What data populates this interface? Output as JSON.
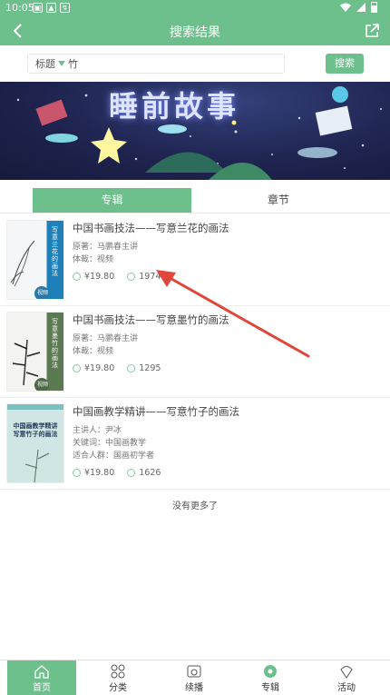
{
  "status_bar": {
    "time": "10:05"
  },
  "header": {
    "title": "搜索结果"
  },
  "search": {
    "field_label": "标题",
    "query": "竹",
    "button_label": "搜索"
  },
  "banner": {
    "title": "睡前故事"
  },
  "tabs": [
    {
      "label": "专辑",
      "active": true
    },
    {
      "label": "章节",
      "active": false
    }
  ],
  "results": [
    {
      "title": "中国书画技法——写意兰花的画法",
      "meta": [
        "原著：马鹏春主讲",
        "体裁：视频"
      ],
      "price": "¥19.80",
      "plays": "1974",
      "cover_side": "写意兰花的画法",
      "cover_badge": "视频"
    },
    {
      "title": "中国书画技法——写意墨竹的画法",
      "meta": [
        "原著：马鹏春主讲",
        "体裁：视频"
      ],
      "price": "¥19.80",
      "plays": "1295",
      "cover_side": "写意墨竹的画法",
      "cover_badge": "视频"
    },
    {
      "title": "中国画教学精讲——写意竹子的画法",
      "meta": [
        "主讲人：尹冰",
        "关键词：中国画教学",
        "适合人群：国画初学者"
      ],
      "price": "¥19.80",
      "plays": "1626",
      "cover_title": "中国画教学精讲 写意竹子的画法"
    }
  ],
  "no_more_text": "没有更多了",
  "bottom_nav": [
    {
      "label": "首页",
      "icon": "home-icon",
      "active": true
    },
    {
      "label": "分类",
      "icon": "category-icon",
      "active": false
    },
    {
      "label": "续播",
      "icon": "resume-icon",
      "active": false
    },
    {
      "label": "专辑",
      "icon": "album-icon",
      "active": false
    },
    {
      "label": "活动",
      "icon": "activity-icon",
      "active": false
    }
  ],
  "colors": {
    "brand": "#6dbf8c",
    "arrow": "#e0463a",
    "banner_bg": "#1f2450"
  }
}
